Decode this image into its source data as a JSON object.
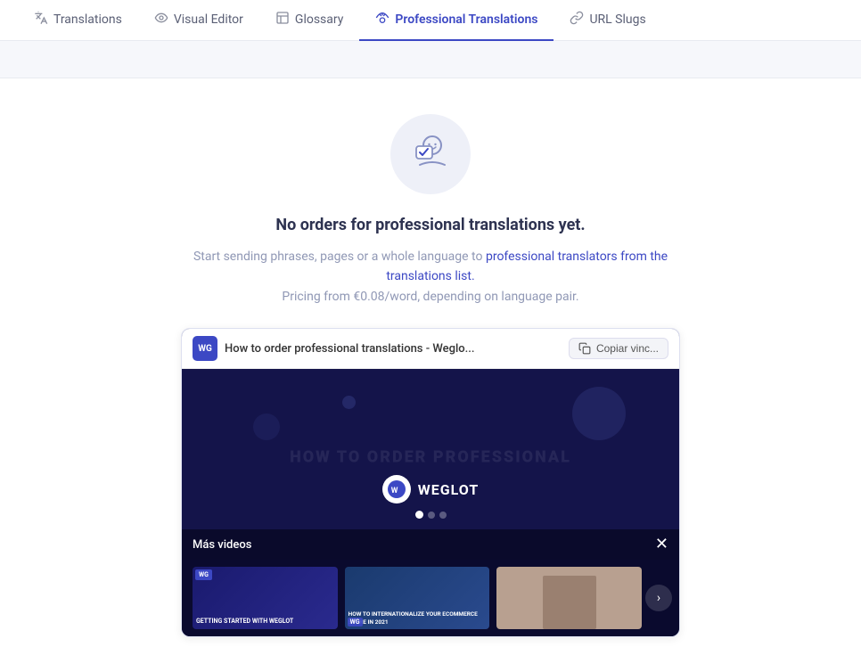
{
  "nav": {
    "items": [
      {
        "id": "translations",
        "label": "Translations",
        "icon": "⇄",
        "active": false
      },
      {
        "id": "visual-editor",
        "label": "Visual Editor",
        "icon": "👁",
        "active": false
      },
      {
        "id": "glossary",
        "label": "Glossary",
        "icon": "📋",
        "active": false
      },
      {
        "id": "professional-translations",
        "label": "Professional Translations",
        "icon": "∿",
        "active": true
      },
      {
        "id": "url-slugs",
        "label": "URL Slugs",
        "icon": "∿",
        "active": false
      }
    ]
  },
  "empty_state": {
    "title": "No orders for professional translations yet.",
    "subtitle_part1": "Start sending phrases, pages or a whole language to ",
    "subtitle_link": "professional translators from the translations list.",
    "subtitle_part2": "Pricing from €0.08/word, depending on language pair."
  },
  "video": {
    "top_bar_title": "How to order professional translations - Weglo...",
    "copy_button": "Copiar vinc...",
    "wg_logo": "WG",
    "brand_name": "WEGLOT",
    "bg_text": "HOW TO ORDER PROFESSIONAL",
    "more_videos_label": "Más videos",
    "thumb1_badge": "WG",
    "thumb1_text": "GETTING STARTED WITH WEGLOT",
    "thumb2_text": "HOW TO INTERNATIONALIZE YOUR ECOMMERCE STORE IN 2021",
    "next_icon": "›"
  }
}
